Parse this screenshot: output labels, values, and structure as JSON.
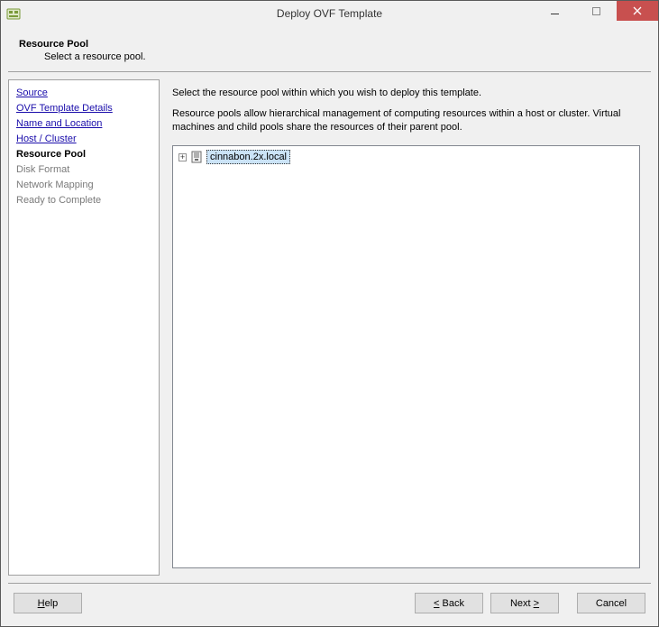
{
  "window": {
    "title": "Deploy OVF Template"
  },
  "header": {
    "title": "Resource Pool",
    "subtitle": "Select a resource pool."
  },
  "sidebar": {
    "steps": [
      {
        "label": "Source",
        "state": "link"
      },
      {
        "label": "OVF Template Details",
        "state": "link"
      },
      {
        "label": "Name and Location",
        "state": "link"
      },
      {
        "label": "Host / Cluster",
        "state": "link"
      },
      {
        "label": "Resource Pool",
        "state": "current"
      },
      {
        "label": "Disk Format",
        "state": "disabled"
      },
      {
        "label": "Network Mapping",
        "state": "disabled"
      },
      {
        "label": "Ready to Complete",
        "state": "disabled"
      }
    ]
  },
  "main": {
    "desc1": "Select the resource pool within which you wish to deploy this template.",
    "desc2": "Resource pools allow hierarchical management of computing resources within a host or cluster. Virtual machines and child pools share the resources of their parent pool.",
    "tree": {
      "expander": "+",
      "selected_node": "cinnabon.2x.local"
    }
  },
  "footer": {
    "help": "Help",
    "back": "Back",
    "next": "Next",
    "cancel": "Cancel"
  }
}
